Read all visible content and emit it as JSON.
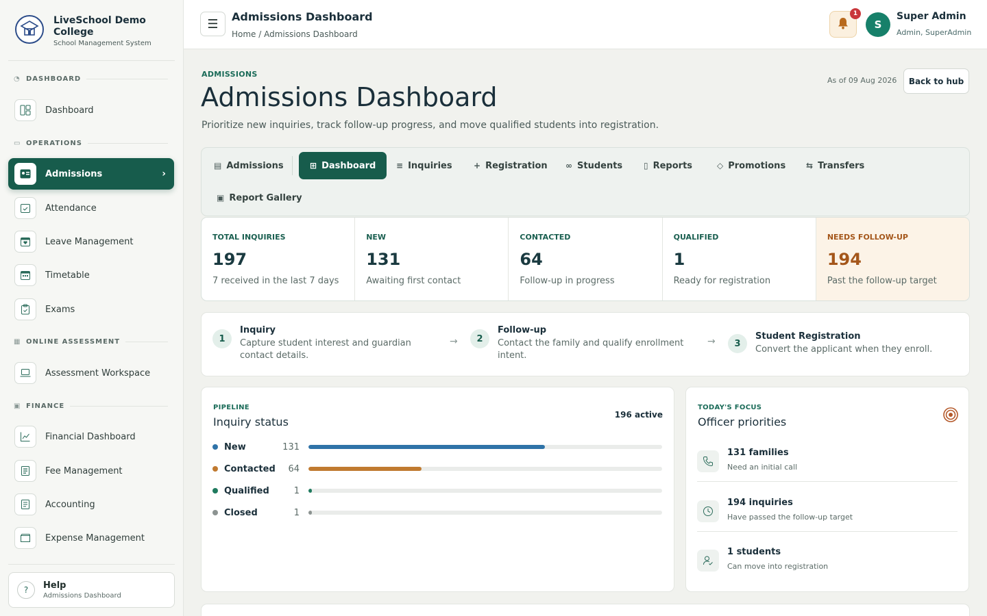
{
  "brand": {
    "name": "LiveSchool Demo College",
    "subtitle": "School Management System"
  },
  "sidebar": {
    "sections": [
      {
        "label": "DASHBOARD"
      },
      {
        "label": "OPERATIONS"
      },
      {
        "label": "ONLINE ASSESSMENT"
      },
      {
        "label": "FINANCE"
      }
    ],
    "items": [
      {
        "label": "Dashboard"
      },
      {
        "label": "Admissions"
      },
      {
        "label": "Attendance"
      },
      {
        "label": "Leave Management"
      },
      {
        "label": "Timetable"
      },
      {
        "label": "Exams"
      },
      {
        "label": "Assessment Workspace"
      },
      {
        "label": "Financial Dashboard"
      },
      {
        "label": "Fee Management"
      },
      {
        "label": "Accounting"
      },
      {
        "label": "Expense Management"
      }
    ],
    "help": {
      "title": "Help",
      "subtitle": "Admissions Dashboard"
    }
  },
  "topbar": {
    "title": "Admissions Dashboard",
    "breadcrumb": "Home / Admissions Dashboard",
    "notification_count": "1",
    "user": {
      "initial": "S",
      "name": "Super Admin",
      "role": "Admin, SuperAdmin"
    }
  },
  "header": {
    "eyebrow": "ADMISSIONS",
    "title": "Admissions Dashboard",
    "description": "Prioritize new inquiries, track follow-up progress, and move qualified students into registration.",
    "as_of": "As of 09 Aug 2026",
    "back_button": "Back to hub"
  },
  "tabs": [
    {
      "label": "Admissions"
    },
    {
      "label": "Dashboard"
    },
    {
      "label": "Inquiries"
    },
    {
      "label": "Registration"
    },
    {
      "label": "Students"
    },
    {
      "label": "Reports"
    },
    {
      "label": "Promotions"
    },
    {
      "label": "Transfers"
    },
    {
      "label": "Report Gallery"
    }
  ],
  "stats": [
    {
      "label": "TOTAL INQUIRIES",
      "value": "197",
      "sub": "7 received in the last 7 days"
    },
    {
      "label": "NEW",
      "value": "131",
      "sub": "Awaiting first contact"
    },
    {
      "label": "CONTACTED",
      "value": "64",
      "sub": "Follow-up in progress"
    },
    {
      "label": "QUALIFIED",
      "value": "1",
      "sub": "Ready for registration"
    },
    {
      "label": "NEEDS FOLLOW-UP",
      "value": "194",
      "sub": "Past the follow-up target"
    }
  ],
  "steps": [
    {
      "num": "1",
      "title": "Inquiry",
      "desc": "Capture student interest and guardian contact details."
    },
    {
      "num": "2",
      "title": "Follow-up",
      "desc": "Contact the family and qualify enrollment intent."
    },
    {
      "num": "3",
      "title": "Student Registration",
      "desc": "Convert the applicant when they enroll."
    }
  ],
  "pipeline": {
    "eyebrow": "PIPELINE",
    "title": "Inquiry status",
    "active": "196 active",
    "rows": [
      {
        "label": "New",
        "count": "131",
        "fraction": 0.668,
        "color": "#2f73a8"
      },
      {
        "label": "Contacted",
        "count": "64",
        "fraction": 0.32,
        "color": "#c07a30"
      },
      {
        "label": "Qualified",
        "count": "1",
        "fraction": 0.008,
        "color": "#1f7a5e"
      },
      {
        "label": "Closed",
        "count": "1",
        "fraction": 0.008,
        "color": "#8c9391"
      }
    ]
  },
  "focus": {
    "eyebrow": "TODAY'S FOCUS",
    "title": "Officer priorities",
    "items": [
      {
        "title": "131 families",
        "sub": "Need an initial call",
        "icon": "phone-icon"
      },
      {
        "title": "194 inquiries",
        "sub": "Have passed the follow-up target",
        "icon": "clock-icon"
      },
      {
        "title": "1 students",
        "sub": "Can move into registration",
        "icon": "user-check-icon"
      }
    ]
  }
}
